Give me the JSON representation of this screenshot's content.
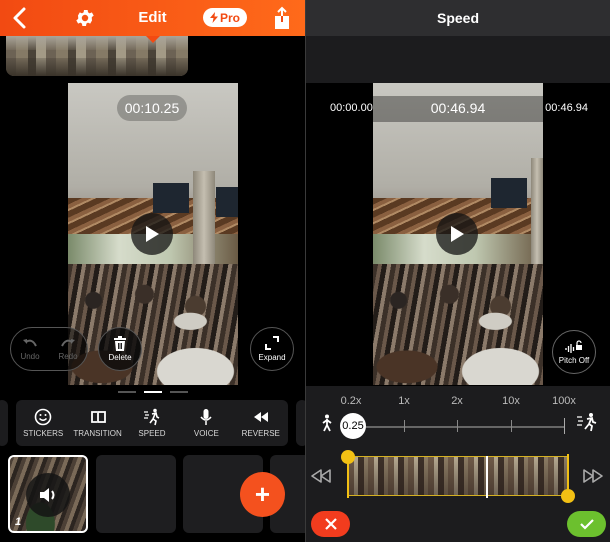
{
  "editor": {
    "header": {
      "title": "Edit",
      "pro_label": "Pro",
      "accent_color": "#f24a12"
    },
    "preview": {
      "current_time": "00:10.25"
    },
    "overlay_buttons": {
      "undo": "Undo",
      "redo": "Redo",
      "delete": "Delete",
      "expand": "Expand"
    },
    "pager": {
      "pages": 3,
      "active": 2
    },
    "tools": [
      {
        "label": "STICKERS",
        "icon": "smiley-icon"
      },
      {
        "label": "TRANSITION",
        "icon": "transition-icon"
      },
      {
        "label": "SPEED",
        "icon": "speed-runner-icon"
      },
      {
        "label": "VOICE",
        "icon": "microphone-icon"
      },
      {
        "label": "REVERSE",
        "icon": "rewind-icon"
      }
    ],
    "clips": [
      {
        "number": "1",
        "selected": true,
        "icon": "volume-icon"
      }
    ],
    "add_clip_icon": "+"
  },
  "speed": {
    "header": {
      "title": "Speed"
    },
    "times": {
      "start": "00:00.00",
      "current": "00:46.94",
      "end": "00:46.94"
    },
    "pitch_button": "Pitch Off",
    "scale_labels": [
      "0.2x",
      "1x",
      "2x",
      "10x",
      "100x"
    ],
    "current_value": "0.25",
    "trim": {
      "start_fraction": 0.0,
      "end_fraction": 1.0,
      "playhead_fraction": 0.63
    },
    "colors": {
      "trim_handle": "#f2c014",
      "cancel": "#f23c1e",
      "confirm": "#6cc02e"
    }
  }
}
